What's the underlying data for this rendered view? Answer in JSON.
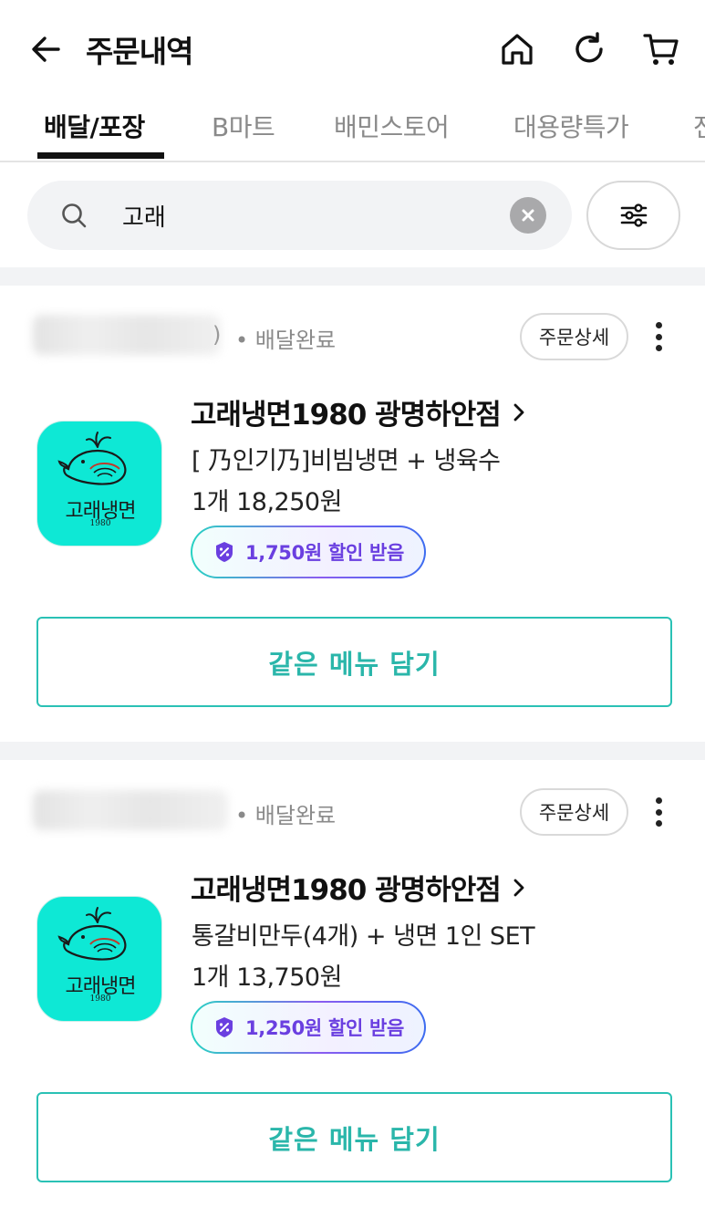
{
  "header": {
    "title": "주문내역",
    "icons": [
      "back-arrow-icon",
      "home-icon",
      "refresh-icon",
      "cart-icon"
    ]
  },
  "tabs": [
    {
      "label": "배달/포장",
      "active": true
    },
    {
      "label": "B마트",
      "active": false
    },
    {
      "label": "배민스토어",
      "active": false
    },
    {
      "label": "대용량특가",
      "active": false
    },
    {
      "label": "전",
      "active": false
    }
  ],
  "search": {
    "value": "고래",
    "icons": [
      "search-icon",
      "clear-icon",
      "filter-icon"
    ]
  },
  "orders": [
    {
      "date_suffix": ")",
      "status": "• 배달완료",
      "detail_label": "주문상세",
      "store_name": "고래냉면1980 광명하안점",
      "menu": "[ 乃인기乃]비빔냉면 + 냉육수",
      "qty_price": "1개 18,250원",
      "discount": "1,750원 할인 받음",
      "add_label": "같은 메뉴 담기",
      "logo_text": "고래냉면",
      "logo_year": "1980"
    },
    {
      "date_suffix": "",
      "status": "• 배달완료",
      "detail_label": "주문상세",
      "store_name": "고래냉면1980 광명하안점",
      "menu": "통갈비만두(4개) + 냉면 1인 SET",
      "qty_price": "1개 13,750원",
      "discount": "1,250원 할인 받음",
      "add_label": "같은 메뉴 담기",
      "logo_text": "고래냉면",
      "logo_year": "1980"
    }
  ],
  "colors": {
    "accent": "#2ab6aa",
    "logo_bg": "#0ee8d5",
    "discount_text": "#6a3fe0"
  }
}
